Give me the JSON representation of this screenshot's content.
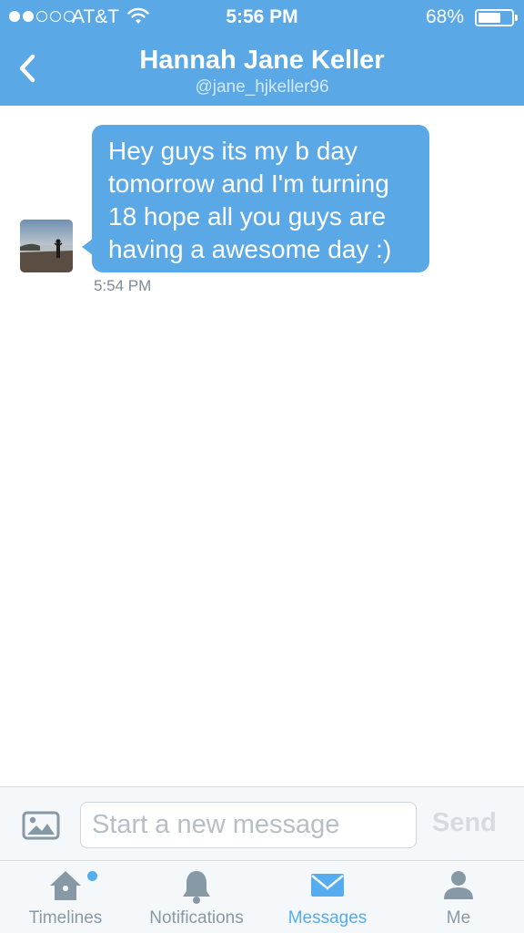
{
  "status_bar": {
    "carrier": "AT&T",
    "time": "5:56 PM",
    "battery_percent": "68%",
    "battery_level": 0.68,
    "signal_bars": 2
  },
  "nav": {
    "title": "Hannah Jane Keller",
    "subtitle": "@jane_hjkeller96",
    "back_icon": "chevron-left-icon"
  },
  "conversation": {
    "messages": [
      {
        "text": "Hey guys its my b day tomorrow and I'm turning 18 hope all you guys are having a awesome day :)",
        "time": "5:54 PM",
        "direction": "incoming"
      }
    ]
  },
  "compose": {
    "placeholder": "Start a new message",
    "send_label": "Send",
    "image_icon": "image-icon"
  },
  "tabs": [
    {
      "label": "Timelines",
      "icon": "home-icon",
      "active": false,
      "unread": true
    },
    {
      "label": "Notifications",
      "icon": "bell-icon",
      "active": false,
      "unread": false
    },
    {
      "label": "Messages",
      "icon": "envelope-icon",
      "active": true,
      "unread": false
    },
    {
      "label": "Me",
      "icon": "person-icon",
      "active": false,
      "unread": false
    }
  ],
  "colors": {
    "accent": "#5aa9e6",
    "active_tab": "#55acee",
    "inactive_tab": "#8899a6"
  }
}
